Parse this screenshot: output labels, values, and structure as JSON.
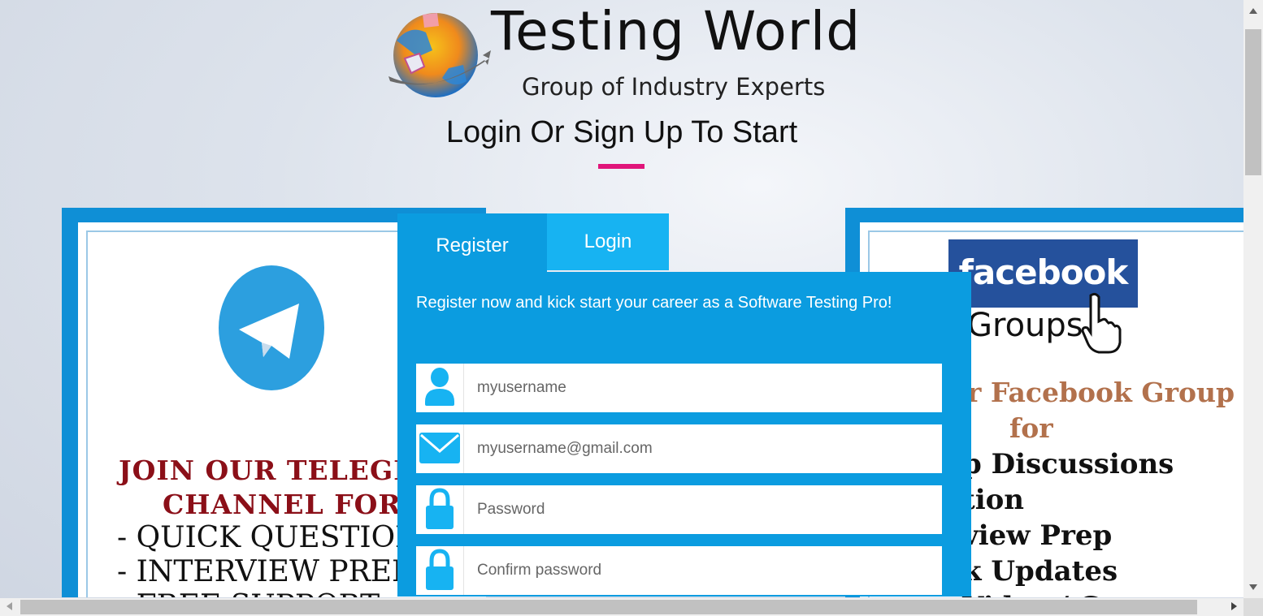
{
  "brand": {
    "title": "Testing World",
    "subtitle": "Group of Industry Experts"
  },
  "page_title": "Login Or Sign Up To Start",
  "colors": {
    "accent_pink": "#e0157a",
    "panel_blue": "#0b9ce0",
    "tab_light_blue": "#17b3f2",
    "icon_blue": "#17b3f2"
  },
  "tabs": {
    "register": "Register",
    "login": "Login",
    "active": "Register"
  },
  "form": {
    "tagline": "Register now and kick start your career as a Software Testing Pro!",
    "fields": [
      {
        "icon": "user-icon",
        "placeholder": "myusername",
        "value": ""
      },
      {
        "icon": "envelope-icon",
        "placeholder": "myusername@gmail.com",
        "value": ""
      },
      {
        "icon": "lock-icon",
        "placeholder": "Password",
        "value": ""
      },
      {
        "icon": "lock-icon",
        "placeholder": "Confirm password",
        "value": ""
      }
    ]
  },
  "left_promo": {
    "heading_line1": "JOIN OUR TELEGI",
    "heading_line2": "CHANNEL  FOR",
    "items": [
      "- QUICK QUESTION",
      "- INTERVIEW PREI",
      "- FREE SUPPORT"
    ]
  },
  "right_promo": {
    "logo_text": "facebook",
    "logo_subtext": "Groups",
    "line1": "ur Facebook Group",
    "line2": "for",
    "line3": "p Discussions",
    "line4": "tion",
    "line5": "view Prep",
    "line6": "k Updates",
    "line7": "Video / C"
  }
}
